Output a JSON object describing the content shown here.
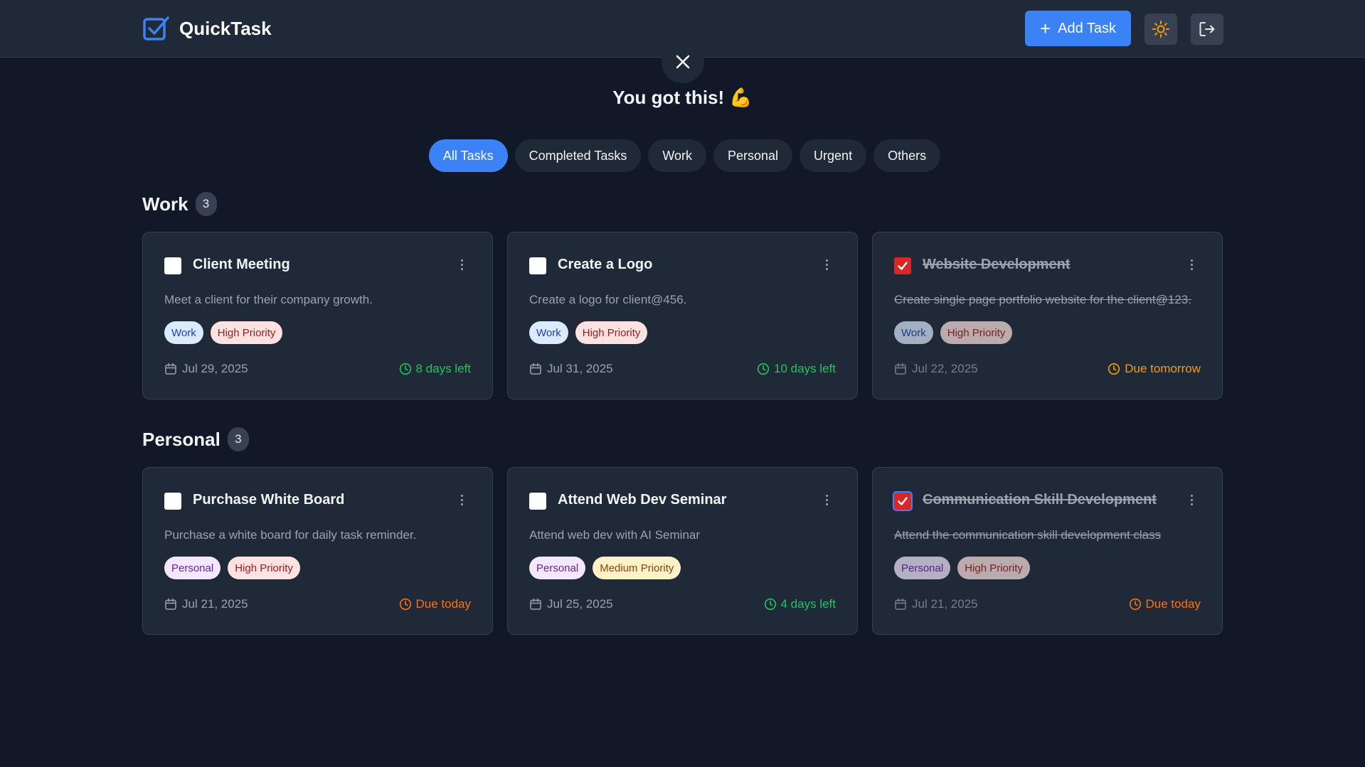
{
  "app": {
    "name": "QuickTask"
  },
  "header": {
    "add_task_label": "Add Task"
  },
  "motivation": "You got this! 💪",
  "filters": [
    {
      "label": "All Tasks",
      "active": true
    },
    {
      "label": "Completed Tasks",
      "active": false
    },
    {
      "label": "Work",
      "active": false
    },
    {
      "label": "Personal",
      "active": false
    },
    {
      "label": "Urgent",
      "active": false
    },
    {
      "label": "Others",
      "active": false
    }
  ],
  "sections": [
    {
      "title": "Work",
      "count": "3",
      "tasks": [
        {
          "title": "Client Meeting",
          "desc": "Meet a client for their company growth.",
          "completed": false,
          "category": "Work",
          "priority": "High Priority",
          "date": "Jul 29, 2025",
          "due": "8 days left"
        },
        {
          "title": "Create a Logo",
          "desc": "Create a logo for client@456.",
          "completed": false,
          "category": "Work",
          "priority": "High Priority",
          "date": "Jul 31, 2025",
          "due": "10 days left"
        },
        {
          "title": "Website Development",
          "desc": "Create single page portfolio website for the client@123.",
          "completed": true,
          "category": "Work",
          "priority": "High Priority",
          "date": "Jul 22, 2025",
          "due": "Due tomorrow"
        }
      ]
    },
    {
      "title": "Personal",
      "count": "3",
      "tasks": [
        {
          "title": "Purchase White Board",
          "desc": "Purchase a white board for daily task reminder.",
          "completed": false,
          "category": "Personal",
          "priority": "High Priority",
          "date": "Jul 21, 2025",
          "due": "Due today"
        },
        {
          "title": "Attend Web Dev Seminar",
          "desc": "Attend web dev with AI Seminar",
          "completed": false,
          "category": "Personal",
          "priority": "Medium Priority",
          "date": "Jul 25, 2025",
          "due": "4 days left"
        },
        {
          "title": "Communication Skill Development",
          "desc": "Attend the communication skill development class",
          "completed": true,
          "category": "Personal",
          "priority": "High Priority",
          "date": "Jul 21, 2025",
          "due": "Due today"
        }
      ]
    }
  ],
  "colors": {
    "background": "#111827",
    "card": "#1f2937",
    "accent": "#3b82f6",
    "due_soon": "#22c55e",
    "due_today": "#f97316",
    "due_tomorrow": "#f59e0b",
    "checked": "#dc2626"
  }
}
